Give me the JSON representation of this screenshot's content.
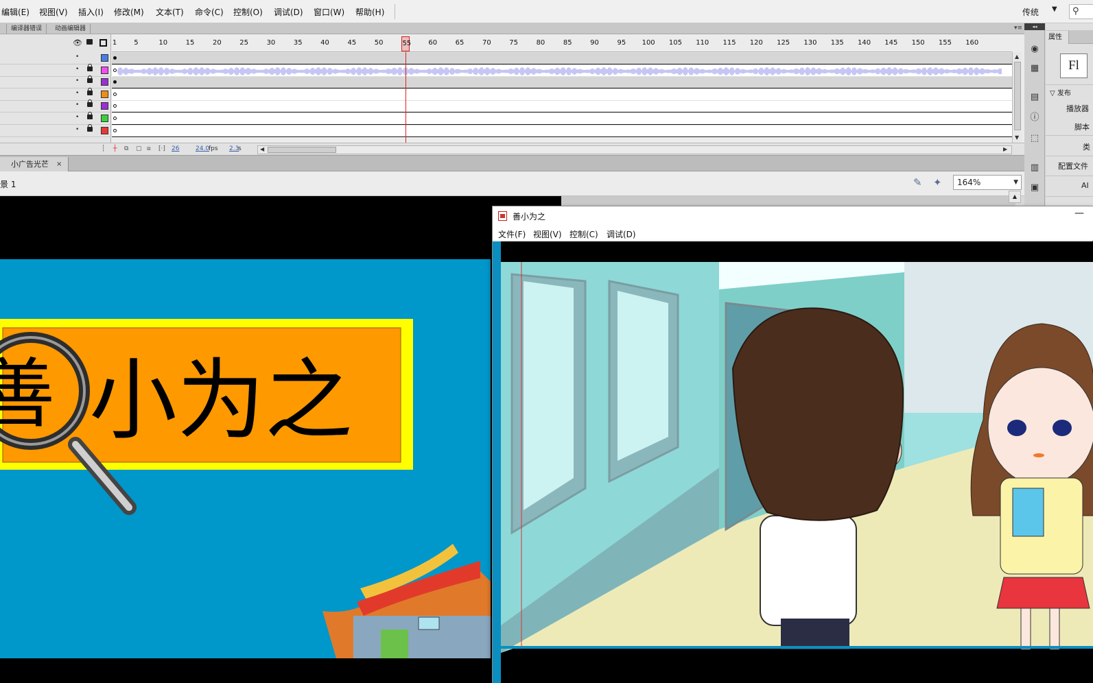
{
  "menubar": {
    "items": [
      "编辑(E)",
      "视图(V)",
      "插入(I)",
      "修改(M)",
      "文本(T)",
      "命令(C)",
      "控制(O)",
      "调试(D)",
      "窗口(W)",
      "帮助(H)"
    ],
    "workspace": "传统",
    "workspace_caret": "▼",
    "search_icon": "search-icon"
  },
  "timeline": {
    "tabs": [
      "编译器错误",
      "动画编辑器"
    ],
    "panel_menu": "▾≡",
    "header_icons": [
      "eye-icon",
      "lock-icon",
      "outline-icon"
    ],
    "ruler_ticks": [
      "1",
      "5",
      "10",
      "15",
      "20",
      "25",
      "30",
      "35",
      "40",
      "45",
      "50",
      "55",
      "60",
      "65",
      "70",
      "75",
      "80",
      "85",
      "90",
      "95",
      "100",
      "105",
      "110",
      "115",
      "120",
      "125",
      "130",
      "135",
      "140",
      "145",
      "150",
      "155",
      "160"
    ],
    "current_frame": "55",
    "layers": [
      {
        "color": "#4a7fe0",
        "keyframe": "solid",
        "selected": true,
        "audio": false
      },
      {
        "color": "#f04ef0",
        "keyframe": "hollow",
        "selected": false,
        "audio": true
      },
      {
        "color": "#9b30d0",
        "keyframe": "solid",
        "selected": true,
        "audio": false
      },
      {
        "color": "#f08c1a",
        "keyframe": "hollow",
        "selected": false,
        "audio": false
      },
      {
        "color": "#9b30d0",
        "keyframe": "hollow",
        "selected": false,
        "audio": false
      },
      {
        "color": "#3ccf3c",
        "keyframe": "hollow",
        "selected": false,
        "audio": false
      },
      {
        "color": "#e83838",
        "keyframe": "hollow",
        "selected": false,
        "audio": false
      }
    ],
    "footer": {
      "frame": "26",
      "fps": "24.0",
      "fps_unit": "fps",
      "time": "2.3",
      "time_unit": "s"
    }
  },
  "document": {
    "tab": "小广告光芒",
    "tab_close": "×",
    "scene": "景 1",
    "zoom": "164%"
  },
  "properties": {
    "tab": "属性",
    "logo": "Fl",
    "section_publish": "▽ 发布",
    "player_label": "播放器",
    "script_label": "脚本",
    "class_label": "类",
    "profile_label": "配置文件",
    "ai_label": "AI",
    "collapse": "◂◂",
    "rail_icons": [
      "palette-icon",
      "swatches-icon",
      "align-icon",
      "info-icon",
      "transform-icon",
      "library-icon",
      "components-icon"
    ]
  },
  "stage_artwork": {
    "title": "善小为之"
  },
  "player": {
    "title": "善小为之",
    "minimize": "—",
    "menus": [
      "文件(F)",
      "视图(V)",
      "控制(C)",
      "调试(D)"
    ]
  }
}
